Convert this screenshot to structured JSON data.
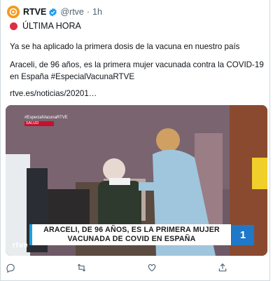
{
  "account": {
    "name": "RTVE",
    "handle": "@rtve",
    "separator": "·",
    "time": "1h"
  },
  "breaking_label": "ÚLTIMA HORA",
  "tweet": {
    "line1": "Ya se ha aplicado la primera dosis de la vacuna en nuestro país",
    "line2": "Araceli, de 96 años, es la primera mujer vacunada contra la COVID-19 en España #EspecialVacunaRTVE",
    "link": "rtve.es/noticias/20201…"
  },
  "video": {
    "banner_line1": "ARACELI, DE 96 AÑOS, ES LA PRIMERA MUJER",
    "banner_line2": "VACUNADA DE COVID EN ESPAÑA",
    "channel": "1",
    "watermark": "rtve",
    "top_tag": "#EspecialVacunaRTVE",
    "top_red_tag": "SALUD"
  },
  "actions": [
    "reply-icon",
    "retweet-icon",
    "like-icon",
    "share-icon"
  ],
  "colors": {
    "brand_orange": "#f39a1e",
    "verified_blue": "#1d9bf0",
    "breaking_red": "#dd2e44",
    "banner_accent": "#1aa0e0",
    "channel_blue": "#1f78c8"
  }
}
